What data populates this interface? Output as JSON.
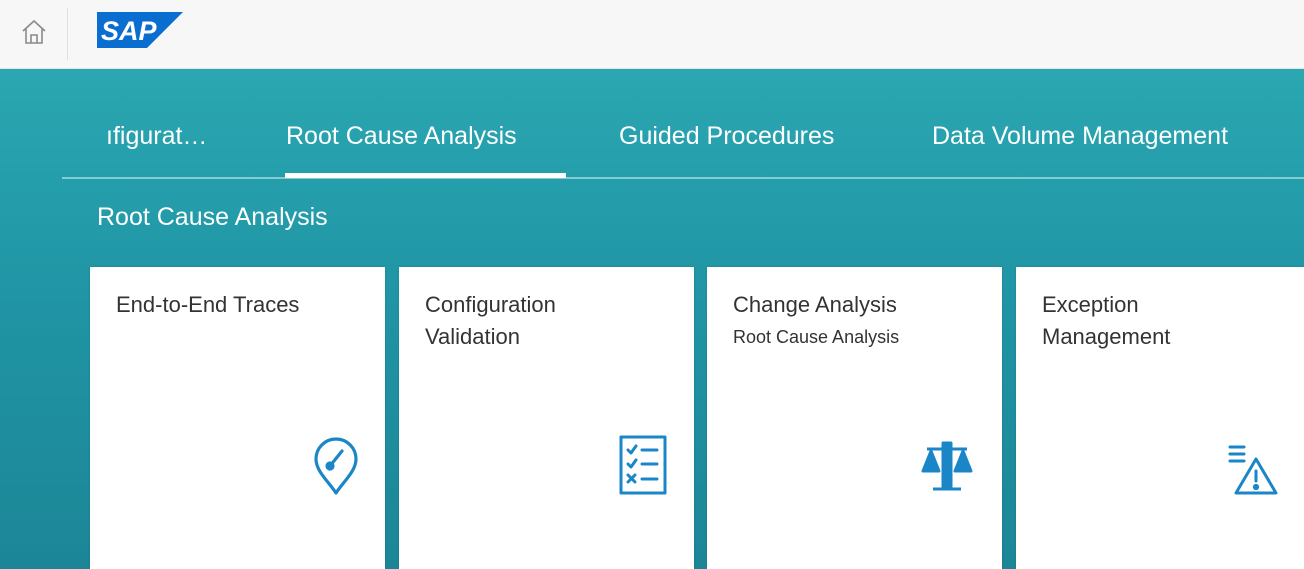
{
  "shell": {
    "home_icon": "home-icon",
    "logo_text": "SAP",
    "logo_color": "#0a6ed1"
  },
  "tabs": [
    {
      "label": "Configuration",
      "display": "ıfigurat…"
    },
    {
      "label": "Root Cause Analysis",
      "selected": true
    },
    {
      "label": "Guided Procedures"
    },
    {
      "label": "Data Volume Management"
    }
  ],
  "section": {
    "title": "Root Cause Analysis"
  },
  "tiles": [
    {
      "title": "End-to-End Traces",
      "subtitle": "",
      "icon": "gauge-pin-icon"
    },
    {
      "title": "Configuration Validation",
      "subtitle": "",
      "icon": "checklist-icon"
    },
    {
      "title": "Change Analysis",
      "subtitle": "Root Cause Analysis",
      "icon": "balance-scale-icon"
    },
    {
      "title": "Exception Management",
      "subtitle": "",
      "icon": "list-warning-icon"
    }
  ],
  "colors": {
    "accent": "#2aa7b1",
    "icon": "#1a86c7",
    "tile_text": "#333333"
  }
}
